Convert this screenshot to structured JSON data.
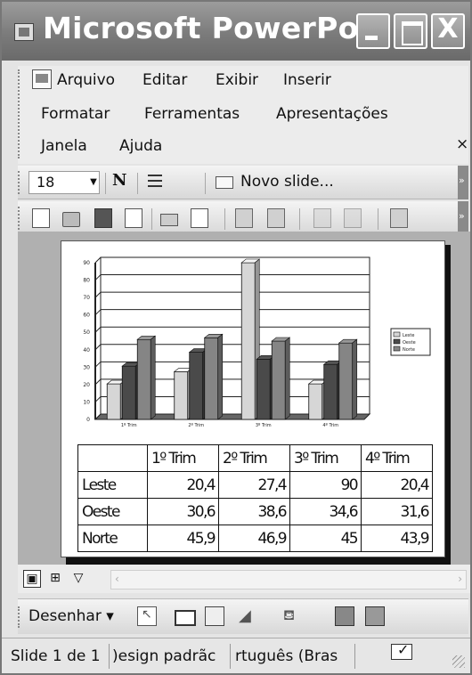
{
  "window": {
    "title": "Microsoft PowerPoi...",
    "close_glyph": "X"
  },
  "menubar": {
    "items": [
      "Arquivo",
      "Editar",
      "Exibir",
      "Inserir",
      "Formatar",
      "Ferramentas",
      "Apresentações",
      "Janela",
      "Ajuda"
    ],
    "close_glyph": "×"
  },
  "formatting_toolbar": {
    "font_size": "18",
    "bold_label": "N",
    "new_slide_label": "Novo slide..."
  },
  "standard_toolbar": {
    "icons": [
      "new-document-icon",
      "open-folder-icon",
      "save-disk-icon",
      "permission-icon",
      "print-icon",
      "print-preview-icon",
      "spelling-icon",
      "research-icon",
      "cut-icon",
      "format-painter-icon",
      "chart-icon"
    ]
  },
  "chart_data": {
    "type": "bar",
    "categories": [
      "1º Trim",
      "2º Trim",
      "3º Trim",
      "4º Trim"
    ],
    "series": [
      {
        "name": "Leste",
        "values": [
          20.4,
          27.4,
          90,
          20.4
        ],
        "color": "#d6d6d6"
      },
      {
        "name": "Oeste",
        "values": [
          30.6,
          38.6,
          34.6,
          31.6
        ],
        "color": "#4a4a4a"
      },
      {
        "name": "Norte",
        "values": [
          45.9,
          46.9,
          45,
          43.9
        ],
        "color": "#858585"
      }
    ],
    "ylim": [
      0,
      90
    ],
    "yticks": [
      0,
      10,
      20,
      30,
      40,
      50,
      60,
      70,
      80,
      90
    ],
    "grid": true,
    "legend": "right",
    "style": "3d-clustered-column"
  },
  "datasheet": {
    "headers": [
      "",
      "1º Trim",
      "2º Trim",
      "3º Trim",
      "4º Trim"
    ],
    "rows": [
      [
        "Leste",
        "20,4",
        "27,4",
        "90",
        "20,4"
      ],
      [
        "Oeste",
        "30,6",
        "38,6",
        "34,6",
        "31,6"
      ],
      [
        "Norte",
        "45,9",
        "46,9",
        "45",
        "43,9"
      ]
    ]
  },
  "viewbar": {
    "views": [
      "normal-view-icon",
      "slide-sorter-view-icon",
      "slide-show-icon"
    ]
  },
  "drawing_toolbar": {
    "draw_label": "Desenhar ▾",
    "icons": [
      "select-cursor-icon",
      "rectangle-icon",
      "textbox-icon",
      "wordart-icon",
      "fill-color-icon",
      "shadow-style-icon",
      "3d-style-icon"
    ]
  },
  "statusbar": {
    "slide_info": "Slide 1 de 1",
    "design": ")esign padrãc",
    "language": "rtuguês (Bras"
  }
}
